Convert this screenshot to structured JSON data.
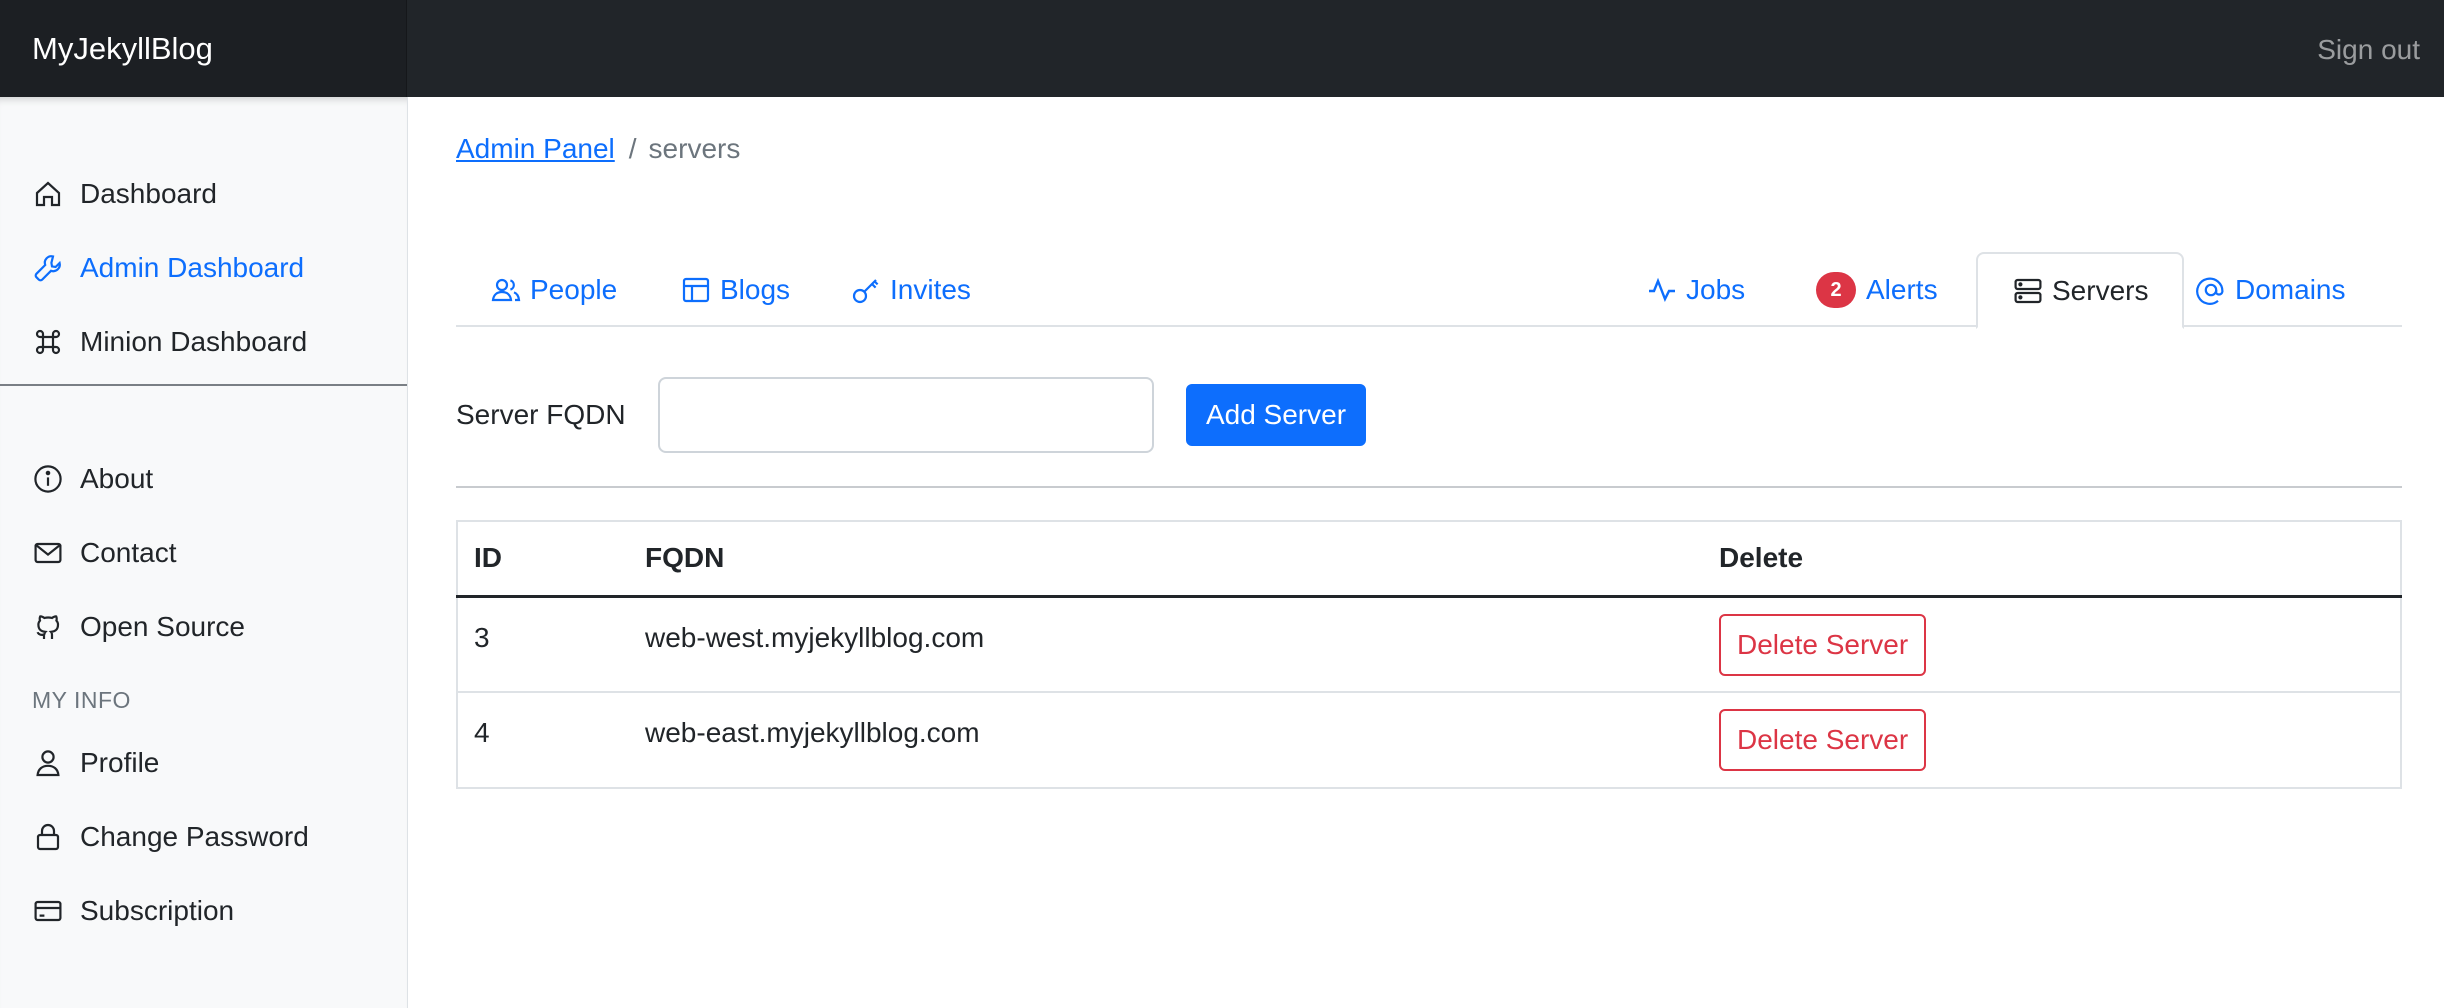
{
  "app": {
    "brand": "MyJekyllBlog",
    "signout_label": "Sign out"
  },
  "sidebar": {
    "main_items": [
      {
        "label": "Dashboard",
        "icon": "home-icon",
        "active": false
      },
      {
        "label": "Admin Dashboard",
        "icon": "wrench-icon",
        "active": true
      },
      {
        "label": "Minion Dashboard",
        "icon": "command-icon",
        "active": false
      }
    ],
    "secondary_items": [
      {
        "label": "About",
        "icon": "info-icon"
      },
      {
        "label": "Contact",
        "icon": "envelope-icon"
      },
      {
        "label": "Open Source",
        "icon": "github-icon"
      }
    ],
    "my_info_heading": "MY INFO",
    "my_info_items": [
      {
        "label": "Profile",
        "icon": "person-icon"
      },
      {
        "label": "Change Password",
        "icon": "lock-icon"
      },
      {
        "label": "Subscription",
        "icon": "credit-card-icon"
      }
    ]
  },
  "breadcrumb": {
    "parent": "Admin Panel",
    "separator": "/",
    "current": "servers"
  },
  "tabs": {
    "people": "People",
    "blogs": "Blogs",
    "invites": "Invites",
    "jobs": "Jobs",
    "alerts": "Alerts",
    "alerts_count": "2",
    "servers": "Servers",
    "domains": "Domains",
    "active": "Servers"
  },
  "form": {
    "label": "Server FQDN",
    "input_value": "",
    "submit_label": "Add Server"
  },
  "table": {
    "headers": {
      "id": "ID",
      "fqdn": "FQDN",
      "delete": "Delete"
    },
    "rows": [
      {
        "id": "3",
        "fqdn": "web-west.myjekyllblog.com",
        "action": "Delete Server"
      },
      {
        "id": "4",
        "fqdn": "web-east.myjekyllblog.com",
        "action": "Delete Server"
      }
    ]
  },
  "colors": {
    "topbar": "#212529",
    "accent": "#0d6efd",
    "danger": "#dc3545",
    "sidebar_bg": "#f8f9fa"
  }
}
